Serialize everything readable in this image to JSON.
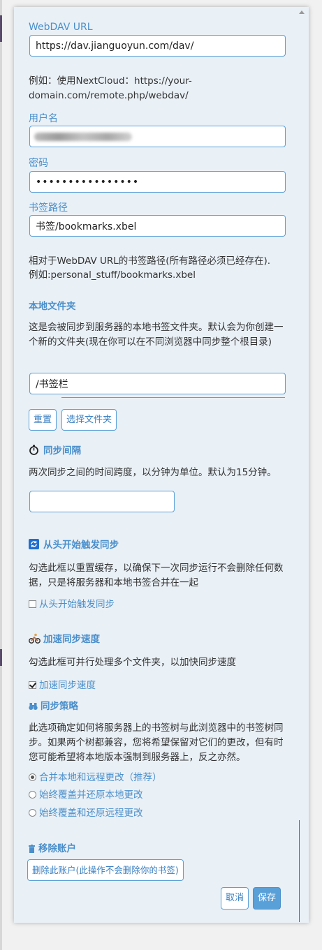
{
  "webdav": {
    "label": "WebDAV URL",
    "value": "https://dav.jianguoyun.com/dav/",
    "hint": "例如：使用NextCloud：https://your-domain.com/remote.php/webdav/"
  },
  "username": {
    "label": "用户名"
  },
  "password": {
    "label": "密码",
    "value": "••••••••••••••••"
  },
  "bookmark_path": {
    "label": "书签路径",
    "value": "书签/bookmarks.xbel",
    "hint_line1": "相对于WebDAV URL的书签路径(所有路径必须已经存在).",
    "hint_line2": "例如:personal_stuff/bookmarks.xbel"
  },
  "local_folder": {
    "heading": "本地文件夹",
    "description": "这是会被同步到服务器的本地书签文件夹。默认会为你创建一个新的文件夹(现在你可以在不同浏览器中同步整个根目录)",
    "value": "/书签栏",
    "reset_label": "重置",
    "choose_label": "选择文件夹"
  },
  "sync_interval": {
    "heading": "同步间隔",
    "description": "两次同步之间的时间跨度，以分钟为单位。默认为15分钟。",
    "value": ""
  },
  "resync": {
    "heading": "从头开始触发同步",
    "description": "勾选此框以重置缓存，以确保下一次同步运行不会删除任何数据，只是将服务器和本地书签合并在一起",
    "checkbox_label": "从头开始触发同步",
    "checked": false
  },
  "speedup": {
    "heading": "加速同步速度",
    "description": "勾选此框可并行处理多个文件夹，以加快同步速度",
    "checkbox_label": "加速同步速度",
    "checked": true
  },
  "strategy": {
    "heading": "同步策略",
    "description": "此选项确定如何将服务器上的书签树与此浏览器中的书签树同步。如果两个树都兼容，您将希望保留对它们的更改，但有时您可能希望将本地版本强制到服务器上，反之亦然。",
    "options": [
      {
        "label": "合并本地和远程更改（推荐）",
        "selected": true
      },
      {
        "label": "始终覆盖并还原本地更改",
        "selected": false
      },
      {
        "label": "始终覆盖和还原远程更改",
        "selected": false
      }
    ]
  },
  "remove_account": {
    "heading": "移除账户",
    "button_label": "删除此账户(此操作不会删除你的书签)"
  },
  "footer": {
    "cancel_label": "取消",
    "save_label": "保存"
  },
  "colors": {
    "accent": "#4a8fcb",
    "input_border": "#5aa0d8",
    "panel_bg": "#e9f0f6",
    "primary_button": "#5aa0d8"
  }
}
